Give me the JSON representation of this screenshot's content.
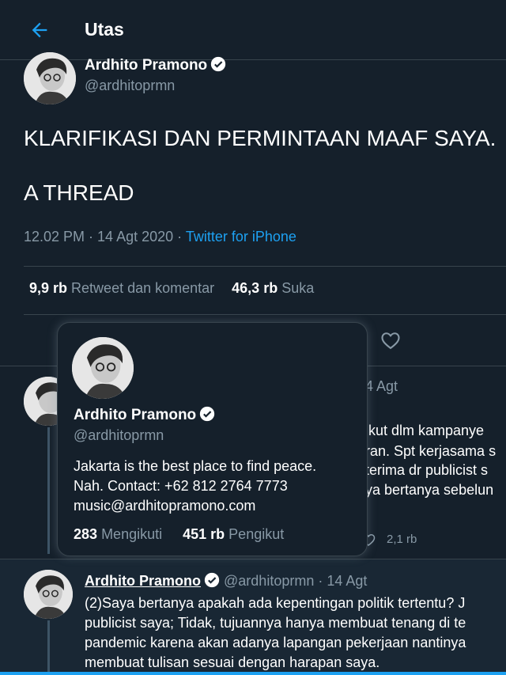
{
  "header": {
    "title": "Utas"
  },
  "tweet": {
    "author_name": "Ardhito Pramono",
    "author_handle": "@ardhitoprmn",
    "text_line1": "KLARIFIKASI DAN PERMINTAAN MAAF SAYA.",
    "text_line2": "A THREAD",
    "time": "12.02 PM",
    "date": "14 Agt 2020",
    "source": "Twitter for iPhone",
    "retweets_count": "9,9 rb",
    "retweets_label": "Retweet dan komentar",
    "likes_count": "46,3 rb",
    "likes_label": "Suka"
  },
  "reply1": {
    "date_fragment": "4 Agt",
    "lines": [
      "ikut dlm kampanye",
      "ran. Spt kerjasama s",
      "terima dr publicist s",
      "ya bertanya sebelun"
    ],
    "like_count": "2,1 rb"
  },
  "reply2": {
    "author_name": "Ardhito Pramono",
    "author_handle": "@ardhitoprmn",
    "separator": "·",
    "date": "14 Agt",
    "lines": [
      "(2)Saya bertanya apakah ada kepentingan politik tertentu? J",
      "publicist saya; Tidak, tujuannya hanya membuat tenang di te",
      "pandemic karena akan adanya lapangan pekerjaan nantinya",
      "membuat tulisan sesuai dengan harapan saya."
    ]
  },
  "hover_card": {
    "name": "Ardhito Pramono",
    "handle": "@ardhitoprmn",
    "bio": [
      "Jakarta is the best place to find peace.",
      "Nah. Contact: +62 812 2764 7773",
      "music@ardhitopramono.com"
    ],
    "following_count": "283",
    "following_label": "Mengikuti",
    "followers_count": "451 rb",
    "followers_label": "Pengikut"
  },
  "icons": {
    "back": "arrow-left-icon",
    "verified": "verified-badge-icon",
    "like": "heart-icon"
  },
  "colors": {
    "background": "#15202b",
    "accent": "#1da1f2",
    "secondary_text": "#8899a6",
    "border": "#38444d"
  }
}
